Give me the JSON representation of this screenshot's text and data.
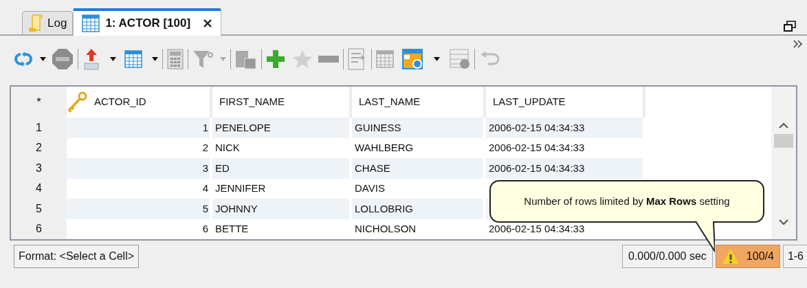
{
  "tabs": [
    {
      "kind": "log",
      "label": "Log",
      "selected": false,
      "closable": false
    },
    {
      "kind": "grid",
      "label": "1: ACTOR [100]",
      "selected": true,
      "closable": true
    }
  ],
  "table": {
    "corner": "*",
    "columns": [
      {
        "label": "ACTOR_ID",
        "primary_key": true,
        "kind": "number"
      },
      {
        "label": "FIRST_NAME",
        "primary_key": false,
        "kind": "text"
      },
      {
        "label": "LAST_NAME",
        "primary_key": false,
        "kind": "text"
      },
      {
        "label": "LAST_UPDATE",
        "primary_key": false,
        "kind": "text"
      }
    ],
    "rows": [
      {
        "number": "1",
        "cells": [
          "1",
          "PENELOPE",
          "GUINESS",
          "2006-02-15 04:34:33"
        ]
      },
      {
        "number": "2",
        "cells": [
          "2",
          "NICK",
          "WAHLBERG",
          "2006-02-15 04:34:33"
        ]
      },
      {
        "number": "3",
        "cells": [
          "3",
          "ED",
          "CHASE",
          "2006-02-15 04:34:33"
        ]
      },
      {
        "number": "4",
        "cells": [
          "4",
          "JENNIFER",
          "DAVIS",
          null
        ]
      },
      {
        "number": "5",
        "cells": [
          "5",
          "JOHNNY",
          "LOLLOBRIG",
          null
        ]
      },
      {
        "number": "6",
        "cells": [
          "6",
          "BETTE",
          "NICHOLSON",
          "2006-02-15 04:34:33"
        ]
      }
    ]
  },
  "tooltip": {
    "text": "Number of rows limited by **Max Rows** setting"
  },
  "status_bar": {
    "format": "Format: <Select a Cell>",
    "timing": "0.000/0.000 sec",
    "row_count": {
      "text": "100/4",
      "warning": true
    },
    "range": "1-6"
  }
}
